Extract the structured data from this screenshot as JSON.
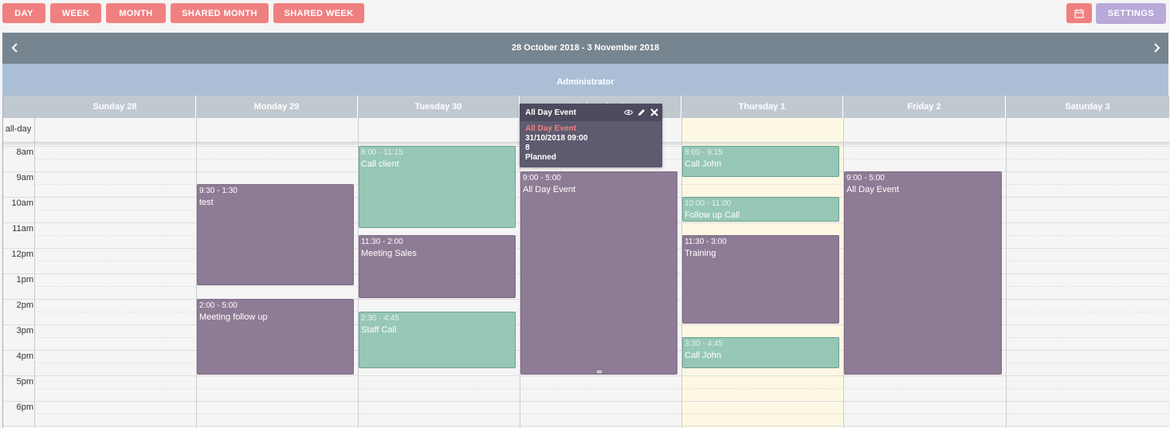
{
  "toolbar": {
    "views": [
      "DAY",
      "WEEK",
      "MONTH",
      "SHARED MONTH",
      "SHARED WEEK"
    ],
    "settings_label": "SETTINGS",
    "accent": "#f08080",
    "settings_color": "#b8a9d9"
  },
  "header": {
    "range": "28 October 2018 - 3 November 2018",
    "user": "Administrator"
  },
  "days": [
    "Sunday 28",
    "Monday 29",
    "Tuesday 30",
    "Wednesday 31",
    "Thursday 1",
    "Friday 2",
    "Saturday 3"
  ],
  "allday_label": "all-day",
  "hours": [
    "8am",
    "9am",
    "10am",
    "11am",
    "12pm",
    "1pm",
    "2pm",
    "3pm",
    "4pm",
    "5pm",
    "6pm"
  ],
  "events": [
    {
      "time": "9:30 - 1:30",
      "title": "test",
      "color": "purple"
    },
    {
      "time": "2:00 - 5:00",
      "title": "Meeting follow up",
      "color": "purple"
    },
    {
      "time": "8:00 - 11:15",
      "title": "Call client",
      "color": "green"
    },
    {
      "time": "11:30 - 2:00",
      "title": "Meeting Sales",
      "color": "purple"
    },
    {
      "time": "2:30 - 4:45",
      "title": "Staff Call",
      "color": "green"
    },
    {
      "time": "9:00 - 5:00",
      "title": "All Day Event",
      "color": "purple"
    },
    {
      "time": "8:00 - 9:15",
      "title": "Call John",
      "color": "green"
    },
    {
      "time": "10:00 - 11:00",
      "title": "Follow up Call",
      "color": "green"
    },
    {
      "time": "11:30 - 3:00",
      "title": "Training",
      "color": "purple"
    },
    {
      "time": "3:30 - 4:45",
      "title": "Call John",
      "color": "green"
    },
    {
      "time": "9:00 - 5:00",
      "title": "All Day Event",
      "color": "purple"
    }
  ],
  "popup": {
    "title": "All Day Event",
    "link": "All Day Event",
    "datetime": "31/10/2018 09:00",
    "duration": "8",
    "status": "Planned"
  }
}
